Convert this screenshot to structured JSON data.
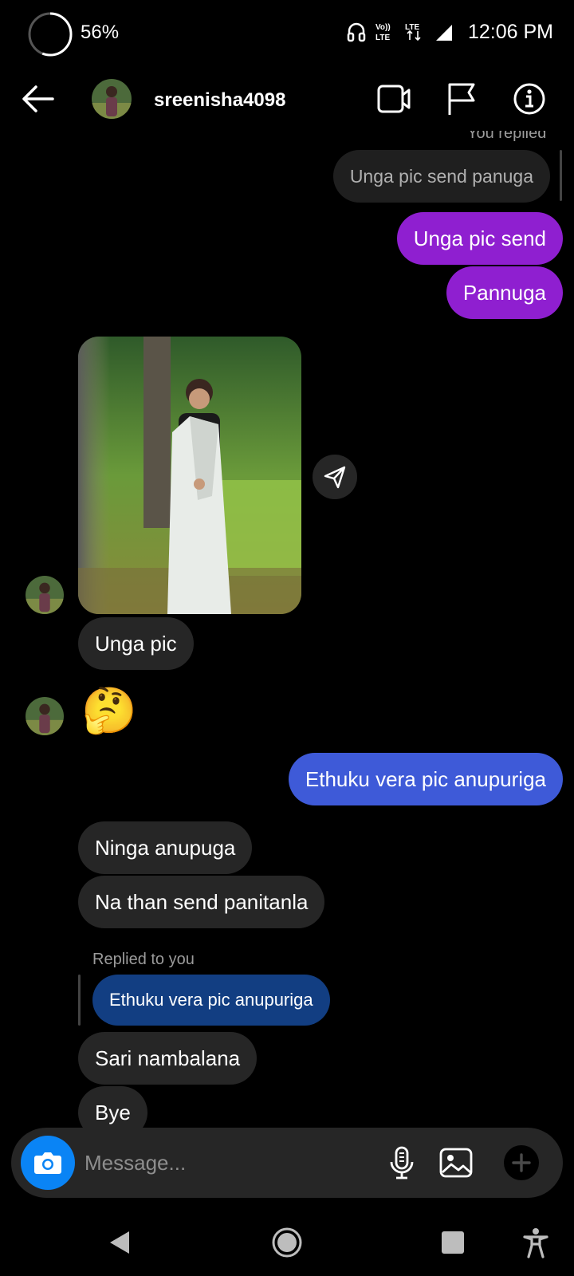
{
  "status_bar": {
    "battery": "56%",
    "time": "12:06 PM",
    "icons": [
      "headphones-icon",
      "volte-icon",
      "lte-signal-icon",
      "signal-icon"
    ],
    "volte_label": "Vo)) LTE",
    "lte_label": "LTE"
  },
  "header": {
    "back_icon": "arrow-left-icon",
    "username": "sreenisha4098",
    "actions": [
      "video-call-icon",
      "flag-icon",
      "info-icon"
    ]
  },
  "messages": {
    "you_replied_label": "You replied",
    "quoted_outgoing": "Unga pic send panuga",
    "sent_1": "Unga pic send",
    "sent_2": "Pannuga",
    "received_photo_caption": "Unga pic",
    "received_emoji": "🤔",
    "sent_3": "Ethuku vera pic anupuriga",
    "received_1": "Ninga anupuga",
    "received_2": "Na than send panitanla",
    "replied_to_you_label": "Replied to you",
    "quoted_incoming": "Ethuku vera pic anupuriga",
    "received_3": "Sari nambalana",
    "received_4": "Bye"
  },
  "composer": {
    "placeholder": "Message...",
    "icons": [
      "camera-icon",
      "microphone-icon",
      "gallery-icon",
      "plus-icon"
    ]
  },
  "nav": {
    "icons": [
      "back-triangle-icon",
      "home-circle-icon",
      "recents-square-icon",
      "accessibility-icon"
    ]
  },
  "colors": {
    "sent_purple": "#8f1fd0",
    "sent_blue": "#3e5ad8",
    "received_gray": "#262626",
    "quoted_blue": "#123e82",
    "camera_blue": "#0a84f5"
  }
}
